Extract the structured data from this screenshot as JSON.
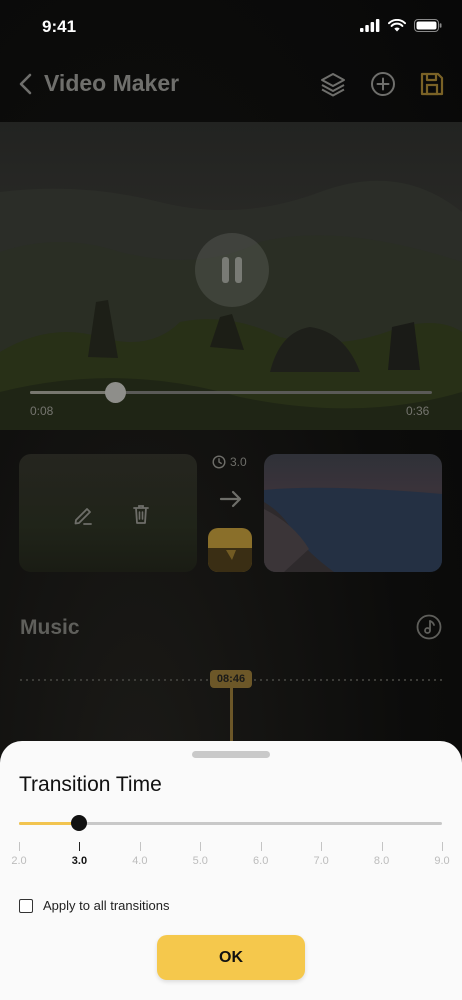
{
  "status_bar": {
    "time": "9:41"
  },
  "nav": {
    "title": "Video Maker"
  },
  "player": {
    "current_time": "0:08",
    "total_time": "0:36",
    "progress": 0.212
  },
  "transition": {
    "duration_label": "3.0"
  },
  "music": {
    "label": "Music",
    "marker_time": "08:46"
  },
  "sheet": {
    "title": "Transition Time",
    "slider": {
      "min": 2.0,
      "max": 9.0,
      "value": 3.0
    },
    "ticks": [
      "2.0",
      "3.0",
      "4.0",
      "5.0",
      "6.0",
      "7.0",
      "8.0",
      "9.0"
    ],
    "active_tick": "3.0",
    "apply_label": "Apply to all transitions",
    "ok_label": "OK"
  },
  "colors": {
    "accent": "#f5c84c",
    "slider_fill": "#f2c44f",
    "sheet_bg": "#fafafa"
  }
}
